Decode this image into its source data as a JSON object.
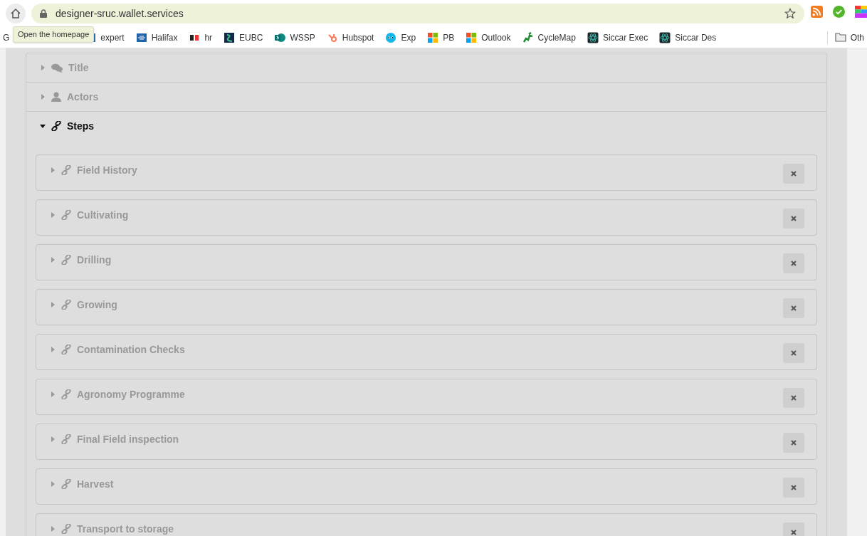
{
  "browser": {
    "url": "designer-sruc.wallet.services",
    "tooltip": "Open the homepage",
    "bookmarks": [
      {
        "label": "G"
      },
      {
        "label": "expert"
      },
      {
        "label": "Halifax"
      },
      {
        "label": "hr"
      },
      {
        "label": "EUBC"
      },
      {
        "label": "WSSP"
      },
      {
        "label": "Hubspot"
      },
      {
        "label": "Exp"
      },
      {
        "label": "PB"
      },
      {
        "label": "Outlook"
      },
      {
        "label": "CycleMap"
      },
      {
        "label": "Siccar Exec"
      },
      {
        "label": "Siccar Des"
      }
    ],
    "other": "Oth"
  },
  "sections": [
    {
      "title": "Title",
      "expanded": false
    },
    {
      "title": "Actors",
      "expanded": false
    },
    {
      "title": "Steps",
      "expanded": true,
      "steps": [
        {
          "title": "Field History",
          "expanded": false
        },
        {
          "title": "Cultivating",
          "expanded": false
        },
        {
          "title": "Drilling",
          "expanded": false
        },
        {
          "title": "Growing",
          "expanded": false
        },
        {
          "title": "Contamination Checks",
          "expanded": false
        },
        {
          "title": "Agronomy Programme",
          "expanded": false
        },
        {
          "title": "Final Field inspection",
          "expanded": false
        },
        {
          "title": "Harvest",
          "expanded": false
        },
        {
          "title": "Transport to storage",
          "expanded": false
        }
      ]
    }
  ]
}
